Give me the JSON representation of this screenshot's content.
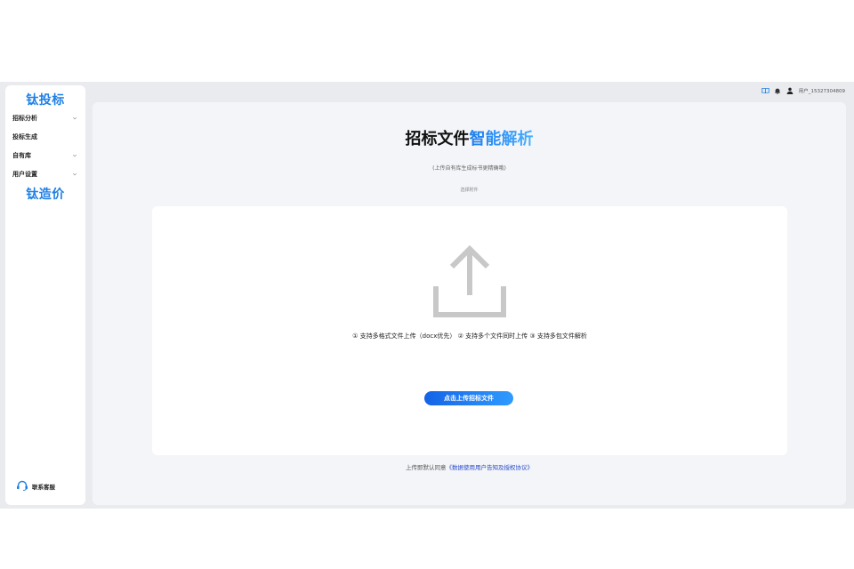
{
  "sidebar": {
    "brand_top": "钛投标",
    "brand_bottom": "钛造价",
    "items": [
      {
        "label": "招标分析",
        "has_children": true
      },
      {
        "label": "投标生成",
        "has_children": false
      },
      {
        "label": "自有库",
        "has_children": true
      },
      {
        "label": "用户设置",
        "has_children": true
      }
    ],
    "support_label": "联系客服"
  },
  "header": {
    "user_label": "用户_15327304809",
    "icons": [
      "book-icon",
      "bell-icon",
      "user-icon"
    ]
  },
  "main": {
    "title_plain": "招标文件",
    "title_accent": "智能解析",
    "subtitle": "(上传自有库生成标书更精确哦)",
    "attach_label": "选择附件",
    "features": "① 支持多格式文件上传（docx优先） ② 支持多个文件同时上传 ③ 支持多包文件解析",
    "upload_button": "点击上传招标文件",
    "agree_prefix": "上传即默认同意",
    "agree_link": "《数据使用用户告知及授权协议》"
  },
  "colors": {
    "accent": "#1d7fe6",
    "button_start": "#1463e6",
    "button_end": "#2f9bff",
    "link": "#2749c9"
  }
}
